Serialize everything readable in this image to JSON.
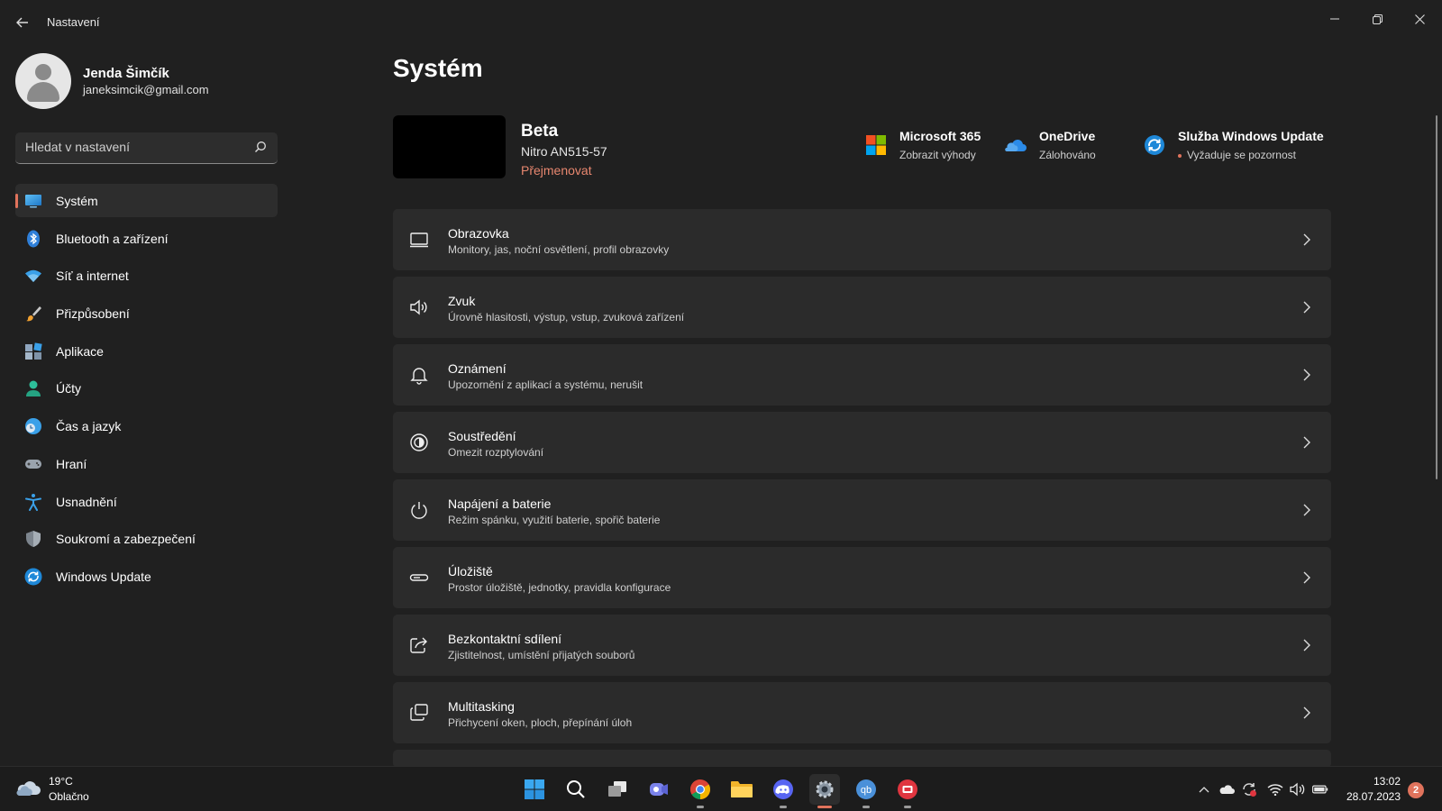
{
  "window": {
    "title": "Nastavení"
  },
  "user": {
    "name": "Jenda Šimčík",
    "email": "janeksimcik@gmail.com"
  },
  "search": {
    "placeholder": "Hledat v nastavení"
  },
  "sidebar": {
    "items": [
      {
        "label": "Systém",
        "icon": "system-icon",
        "active": true
      },
      {
        "label": "Bluetooth a zařízení",
        "icon": "bluetooth-icon"
      },
      {
        "label": "Síť a internet",
        "icon": "wifi-icon"
      },
      {
        "label": "Přizpůsobení",
        "icon": "brush-icon"
      },
      {
        "label": "Aplikace",
        "icon": "apps-icon"
      },
      {
        "label": "Účty",
        "icon": "accounts-icon"
      },
      {
        "label": "Čas a jazyk",
        "icon": "time-language-icon"
      },
      {
        "label": "Hraní",
        "icon": "gamepad-icon"
      },
      {
        "label": "Usnadnění",
        "icon": "accessibility-icon"
      },
      {
        "label": "Soukromí a zabezpečení",
        "icon": "shield-icon"
      },
      {
        "label": "Windows Update",
        "icon": "windows-update-icon"
      }
    ]
  },
  "main": {
    "title": "Systém",
    "device": {
      "name": "Beta",
      "model": "Nitro AN515-57",
      "rename_label": "Přejmenovat"
    },
    "tiles": [
      {
        "title": "Microsoft 365",
        "subtitle": "Zobrazit výhody",
        "icon": "microsoft-365-icon"
      },
      {
        "title": "OneDrive",
        "subtitle": "Zálohováno",
        "icon": "onedrive-icon"
      },
      {
        "title": "Služba Windows Update",
        "subtitle": "Vyžaduje se pozornost",
        "icon": "windows-update-icon"
      }
    ],
    "cards": [
      {
        "title": "Obrazovka",
        "subtitle": "Monitory, jas, noční osvětlení, profil obrazovky",
        "icon": "display-icon"
      },
      {
        "title": "Zvuk",
        "subtitle": "Úrovně hlasitosti, výstup, vstup, zvuková zařízení",
        "icon": "speaker-icon"
      },
      {
        "title": "Oznámení",
        "subtitle": "Upozornění z aplikací a systému, nerušit",
        "icon": "bell-icon"
      },
      {
        "title": "Soustředění",
        "subtitle": "Omezit rozptylování",
        "icon": "focus-icon"
      },
      {
        "title": "Napájení a baterie",
        "subtitle": "Režim spánku, využití baterie, spořič baterie",
        "icon": "power-icon"
      },
      {
        "title": "Úložiště",
        "subtitle": "Prostor úložiště, jednotky, pravidla konfigurace",
        "icon": "storage-icon"
      },
      {
        "title": "Bezkontaktní sdílení",
        "subtitle": "Zjistitelnost, umístění přijatých souborů",
        "icon": "share-icon"
      },
      {
        "title": "Multitasking",
        "subtitle": "Přichycení oken, ploch, přepínání úloh",
        "icon": "multitasking-icon"
      }
    ]
  },
  "taskbar": {
    "weather": {
      "temp": "19°C",
      "condition": "Oblačno"
    },
    "clock": {
      "time": "13:02",
      "date": "28.07.2023"
    },
    "notification_count": "2"
  },
  "colors": {
    "accent": "#e0735c",
    "background": "#202020",
    "card": "#2b2b2b"
  }
}
